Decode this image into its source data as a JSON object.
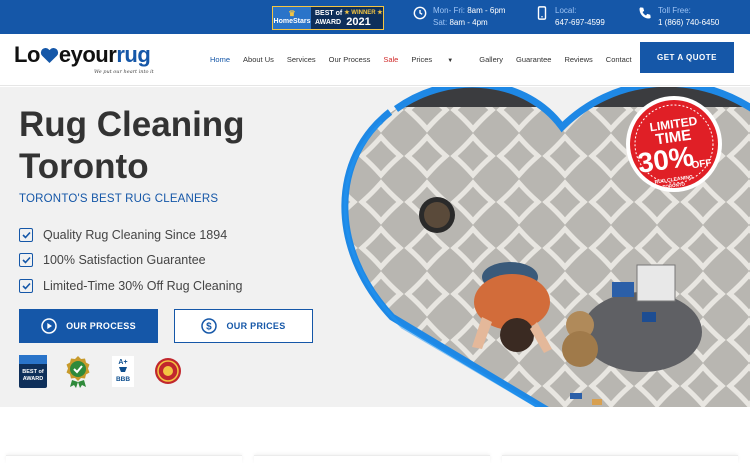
{
  "topbar": {
    "award": {
      "brand": "HomeStars",
      "line1": "BEST of",
      "line2": "AWARD",
      "winner": "WINNER",
      "year": "2021"
    },
    "hours": {
      "line1_label": "Mon- Fri:",
      "line1_value": "8am - 6pm",
      "line2_label": "Sat:",
      "line2_value": "8am - 4pm"
    },
    "local": {
      "label": "Local:",
      "value": "647-697-4599"
    },
    "tollfree": {
      "label": "Toll Free:",
      "value": "1 (866) 740-6450"
    }
  },
  "header": {
    "logo_text_a": "Lo",
    "logo_text_b": "eyour",
    "logo_text_c": "rug",
    "logo_tagline": "We put our heart into it",
    "nav": [
      "Home",
      "About Us",
      "Services",
      "Our Process",
      "Sale",
      "Prices",
      "Gallery",
      "Guarantee",
      "Reviews",
      "Contact"
    ],
    "cta": "GET A QUOTE"
  },
  "hero": {
    "title_line1": "Rug Cleaning",
    "title_line2": "Toronto",
    "subtitle": "TORONTO'S BEST RUG CLEANERS",
    "checks": [
      "Quality Rug Cleaning Since 1894",
      "100% Satisfaction Guarantee",
      "Limited-Time 30% Off Rug Cleaning"
    ],
    "btn_process": "OUR PROCESS",
    "btn_prices": "OUR PRICES",
    "promo": {
      "line1": "LIMITED",
      "line2": "TIME",
      "line3": "30%",
      "line4": "OFF",
      "line5": "RUG CLEANING",
      "line6": "TORONTO"
    },
    "badges": [
      {
        "name": "homestars-badge",
        "text1": "BEST of",
        "text2": "AWARD"
      },
      {
        "name": "guarantee-badge",
        "text1": ""
      },
      {
        "name": "bbb-badge",
        "text1": "A+",
        "text2": "BBB"
      },
      {
        "name": "since-badge",
        "text1": ""
      }
    ]
  },
  "colors": {
    "brand": "#1557a8",
    "sale": "#d12b2b",
    "promo": "#e01f26"
  }
}
